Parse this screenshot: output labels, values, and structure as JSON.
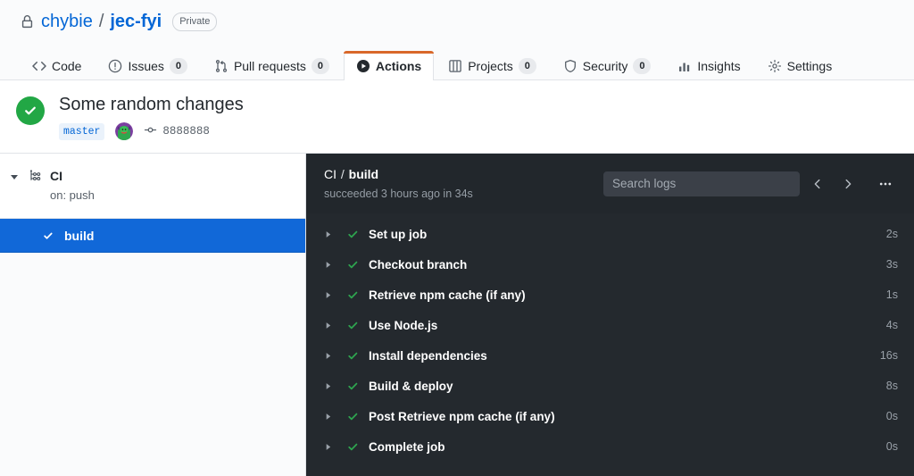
{
  "repo": {
    "visibility_icon": "lock-icon",
    "owner": "chybie",
    "separator": "/",
    "name": "jec-fyi",
    "visibility": "Private"
  },
  "nav": {
    "tabs": [
      {
        "label": "Code",
        "icon": "code-icon",
        "count": null,
        "active": false
      },
      {
        "label": "Issues",
        "icon": "issue-opened-icon",
        "count": "0",
        "active": false
      },
      {
        "label": "Pull requests",
        "icon": "git-pull-request-icon",
        "count": "0",
        "active": false
      },
      {
        "label": "Actions",
        "icon": "play-circle-icon",
        "count": null,
        "active": true
      },
      {
        "label": "Projects",
        "icon": "project-board-icon",
        "count": "0",
        "active": false
      },
      {
        "label": "Security",
        "icon": "shield-icon",
        "count": "0",
        "active": false
      },
      {
        "label": "Insights",
        "icon": "graph-icon",
        "count": null,
        "active": false
      },
      {
        "label": "Settings",
        "icon": "gear-icon",
        "count": null,
        "active": false
      }
    ]
  },
  "run": {
    "status_icon": "check-circle-icon",
    "status_color": "#22a745",
    "title": "Some random changes",
    "branch": "master",
    "avatar_name": "user-avatar",
    "commit_icon": "git-commit-icon",
    "commit_sha": "8888888"
  },
  "sidebar": {
    "toggle_icon": "triangle-down-icon",
    "workflow_icon": "workflow-icon",
    "workflow_name": "CI",
    "workflow_trigger": "on: push",
    "jobs": [
      {
        "name": "build",
        "status_icon": "check-icon",
        "selected": true
      }
    ]
  },
  "log": {
    "breadcrumb_root": "CI",
    "breadcrumb_sep": "/",
    "breadcrumb_leaf": "build",
    "status_text": "succeeded 3 hours ago in 34s",
    "search_placeholder": "Search logs",
    "search_value": "",
    "prev_icon": "chevron-left-icon",
    "next_icon": "chevron-right-icon",
    "kebab_icon": "kebab-horizontal-icon",
    "steps": [
      {
        "name": "Set up job",
        "duration": "2s",
        "status_icon": "check-icon"
      },
      {
        "name": "Checkout branch",
        "duration": "3s",
        "status_icon": "check-icon"
      },
      {
        "name": "Retrieve npm cache (if any)",
        "duration": "1s",
        "status_icon": "check-icon"
      },
      {
        "name": "Use Node.js",
        "duration": "4s",
        "status_icon": "check-icon"
      },
      {
        "name": "Install dependencies",
        "duration": "16s",
        "status_icon": "check-icon"
      },
      {
        "name": "Build & deploy",
        "duration": "8s",
        "status_icon": "check-icon"
      },
      {
        "name": "Post Retrieve npm cache (if any)",
        "duration": "0s",
        "status_icon": "check-icon"
      },
      {
        "name": "Complete job",
        "duration": "0s",
        "status_icon": "check-icon"
      }
    ]
  },
  "colors": {
    "accent_blue": "#0366d6",
    "selected_blue": "#1168d8",
    "success_green": "#22a745",
    "check_green": "#2ea44f",
    "active_tab_underline": "#d9682a",
    "log_bg": "#24292e",
    "log_header_bg": "#22272c"
  }
}
